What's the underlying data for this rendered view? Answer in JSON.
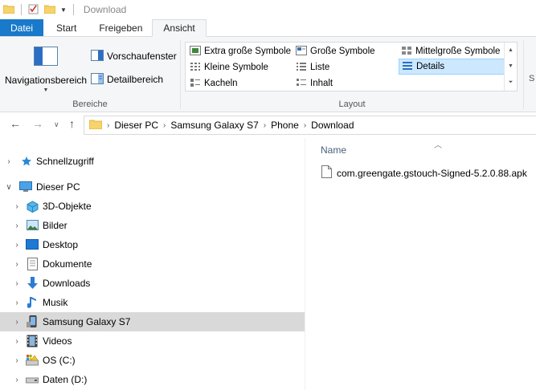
{
  "window": {
    "title": "Download"
  },
  "ribbon": {
    "tabs": [
      {
        "label": "Datei"
      },
      {
        "label": "Start"
      },
      {
        "label": "Freigeben"
      },
      {
        "label": "Ansicht"
      }
    ],
    "groups": {
      "bereiche": {
        "label": "Bereiche",
        "navigation_pane": "Navigationsbereich",
        "preview_pane": "Vorschaufenster",
        "details_pane": "Detailbereich"
      },
      "layout": {
        "label": "Layout",
        "items": [
          {
            "label": "Extra große Symbole"
          },
          {
            "label": "Große Symbole"
          },
          {
            "label": "Mittelgroße Symbole"
          },
          {
            "label": "Kleine Symbole"
          },
          {
            "label": "Liste"
          },
          {
            "label": "Details"
          },
          {
            "label": "Kacheln"
          },
          {
            "label": "Inhalt"
          }
        ],
        "selected": "Details"
      },
      "cut_off_label": "S"
    }
  },
  "address": {
    "breadcrumbs": [
      "Dieser PC",
      "Samsung Galaxy S7",
      "Phone",
      "Download"
    ]
  },
  "navpane": {
    "items": [
      {
        "label": "Schnellzugriff",
        "icon": "star-icon",
        "expanded": false
      },
      {
        "label": "Dieser PC",
        "icon": "computer-icon",
        "expanded": true
      },
      {
        "label": "3D-Objekte",
        "icon": "cube-icon"
      },
      {
        "label": "Bilder",
        "icon": "pictures-icon"
      },
      {
        "label": "Desktop",
        "icon": "desktop-icon"
      },
      {
        "label": "Dokumente",
        "icon": "documents-icon"
      },
      {
        "label": "Downloads",
        "icon": "download-arrow-icon"
      },
      {
        "label": "Musik",
        "icon": "music-note-icon"
      },
      {
        "label": "Samsung Galaxy S7",
        "icon": "phone-icon",
        "selected": true
      },
      {
        "label": "Videos",
        "icon": "film-icon"
      },
      {
        "label": "OS (C:)",
        "icon": "drive-warning-icon"
      },
      {
        "label": "Daten (D:)",
        "icon": "drive-icon"
      }
    ]
  },
  "content": {
    "column_header": "Name",
    "files": [
      {
        "name": "com.greengate.gstouch-Signed-5.2.0.88.apk",
        "icon": "file-icon"
      }
    ]
  },
  "colors": {
    "file_tab": "#1979ca",
    "selected_layout": "#cce8ff",
    "selected_nav": "#d9d9d9",
    "header_text": "#4c607a"
  }
}
